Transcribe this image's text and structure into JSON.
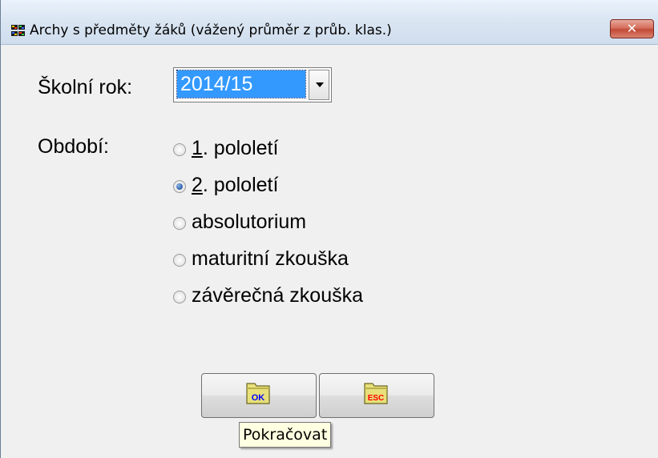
{
  "window": {
    "title": "Archy s předměty žáků (vážený průměr z průb. klas.)",
    "close_label": "✕"
  },
  "school_year": {
    "label": "Školní rok:",
    "selected": "2014/15"
  },
  "period": {
    "label": "Období:",
    "options": [
      {
        "prefix": "1",
        "rest": ". pololetí",
        "checked": false
      },
      {
        "prefix": "2",
        "rest": ". pololetí",
        "checked": true
      },
      {
        "prefix": "",
        "rest": "absolutorium",
        "checked": false
      },
      {
        "prefix": "",
        "rest": "maturitní zkouška",
        "checked": false
      },
      {
        "prefix": "",
        "rest": "závěrečná zkouška",
        "checked": false
      }
    ]
  },
  "buttons": {
    "ok_text": "OK",
    "esc_text": "ESC",
    "tooltip": "Pokračovat"
  },
  "colors": {
    "selection": "#3399ff",
    "ok_icon_text": "#0000ff",
    "esc_icon_text": "#ff0000",
    "folder": "#e8e07a"
  }
}
